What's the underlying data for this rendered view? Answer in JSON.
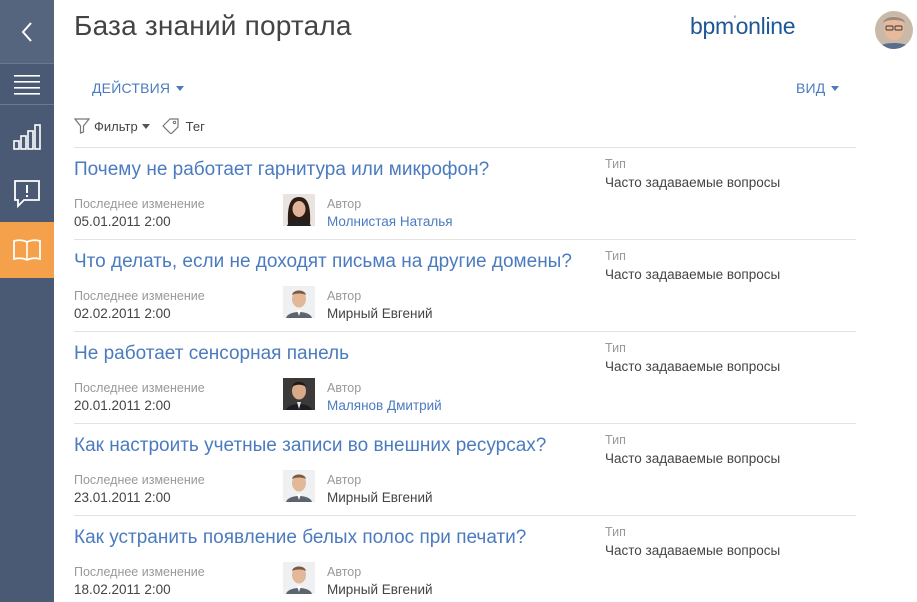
{
  "header": {
    "title": "База знаний портала",
    "logo_main": "bpm",
    "logo_sup": "'",
    "logo_tail": "online"
  },
  "toolbar": {
    "actions_label": "ДЕЙСТВИЯ",
    "view_label": "ВИД",
    "filter_label": "Фильтр",
    "tag_label": "Тег"
  },
  "colors": {
    "sidebar": "#4b5a74",
    "sidebar_active": "#f5a04b",
    "accent_link": "#4b7bbf"
  },
  "sidebar": {
    "items": [
      {
        "icon": "back-arrow-icon"
      },
      {
        "icon": "menu-icon"
      },
      {
        "icon": "analytics-icon"
      },
      {
        "icon": "cases-icon"
      },
      {
        "icon": "knowledge-base-icon",
        "active": true
      }
    ]
  },
  "list": {
    "modified_label": "Последнее изменение",
    "author_label": "Автор",
    "type_label": "Тип",
    "items": [
      {
        "title": "Почему не работает гарнитура или микрофон?",
        "modified": "05.01.2011 2:00",
        "author": "Молнистая Наталья",
        "author_link": true,
        "type": "Часто задаваемые вопросы",
        "photo": "female"
      },
      {
        "title": "Что делать, если не доходят письма на другие домены?",
        "modified": "02.02.2011 2:00",
        "author": "Мирный Евгений",
        "author_link": false,
        "type": "Часто задаваемые вопросы",
        "photo": "male-light"
      },
      {
        "title": "Не работает сенсорная панель",
        "modified": "20.01.2011 2:00",
        "author": "Малянов Дмитрий",
        "author_link": true,
        "type": "Часто задаваемые вопросы",
        "photo": "male-dark"
      },
      {
        "title": "Как настроить учетные записи во внешних ресурсах?",
        "modified": "23.01.2011 2:00",
        "author": "Мирный Евгений",
        "author_link": false,
        "type": "Часто задаваемые вопросы",
        "photo": "male-light"
      },
      {
        "title": "Как устранить появление белых полос при печати?",
        "modified": "18.02.2011 2:00",
        "author": "Мирный Евгений",
        "author_link": false,
        "type": "Часто задаваемые вопросы",
        "photo": "male-light"
      }
    ]
  }
}
